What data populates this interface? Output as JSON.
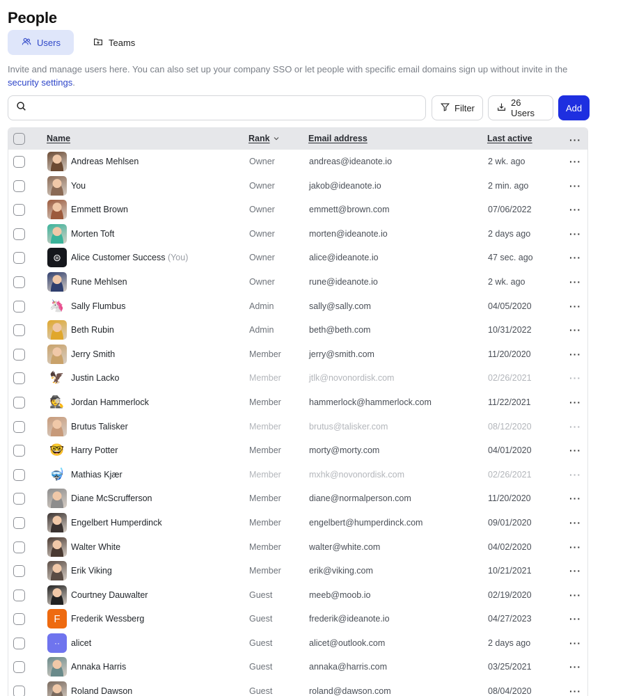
{
  "page": {
    "title": "People"
  },
  "tabs": [
    {
      "label": "Users",
      "icon": "users-icon",
      "active": true
    },
    {
      "label": "Teams",
      "icon": "folder-plus-icon",
      "active": false
    }
  ],
  "intro": {
    "text": "Invite and manage users here. You can also set up your company SSO or let people with specific email domains sign up without invite in the ",
    "link": "security settings",
    "suffix": "."
  },
  "toolbar": {
    "search_placeholder": "",
    "filter_label": "Filter",
    "users_label": "26 Users",
    "add_label": "Add"
  },
  "table": {
    "headers": {
      "name": "Name",
      "rank": "Rank",
      "email": "Email address",
      "last_active": "Last active"
    },
    "rows": [
      {
        "name": "Andreas Mehlsen",
        "suffix": "",
        "rank": "Owner",
        "email": "andreas@ideanote.io",
        "last_active": "2 wk. ago",
        "dim": false,
        "avatar": {
          "kind": "photo",
          "bg": "#6b4a33",
          "glyph": ""
        }
      },
      {
        "name": "You",
        "suffix": "",
        "rank": "Owner",
        "email": "jakob@ideanote.io",
        "last_active": "2 min. ago",
        "dim": false,
        "avatar": {
          "kind": "photo",
          "bg": "#8a6a55",
          "glyph": ""
        }
      },
      {
        "name": "Emmett Brown",
        "suffix": "",
        "rank": "Owner",
        "email": "emmett@brown.com",
        "last_active": "07/06/2022",
        "dim": false,
        "avatar": {
          "kind": "photo",
          "bg": "#9c5a3c",
          "glyph": ""
        }
      },
      {
        "name": "Morten Toft",
        "suffix": "",
        "rank": "Owner",
        "email": "morten@ideanote.io",
        "last_active": "2 days ago",
        "dim": false,
        "avatar": {
          "kind": "photo",
          "bg": "#3ab39a",
          "glyph": ""
        }
      },
      {
        "name": "Alice Customer Success",
        "suffix": "(You)",
        "rank": "Owner",
        "email": "alice@ideanote.io",
        "last_active": "47 sec. ago",
        "dim": false,
        "avatar": {
          "kind": "logo",
          "bg": "#15171c",
          "glyph": "⊜"
        }
      },
      {
        "name": "Rune Mehlsen",
        "suffix": "",
        "rank": "Owner",
        "email": "rune@ideanote.io",
        "last_active": "2 wk. ago",
        "dim": false,
        "avatar": {
          "kind": "photo",
          "bg": "#2f3f6e",
          "glyph": ""
        }
      },
      {
        "name": "Sally Flumbus",
        "suffix": "",
        "rank": "Admin",
        "email": "sally@sally.com",
        "last_active": "04/05/2020",
        "dim": false,
        "avatar": {
          "kind": "emoji",
          "bg": "#ffffff",
          "glyph": "🦄"
        }
      },
      {
        "name": "Beth Rubin",
        "suffix": "",
        "rank": "Admin",
        "email": "beth@beth.com",
        "last_active": "10/31/2022",
        "dim": false,
        "avatar": {
          "kind": "photo",
          "bg": "#e0a72c",
          "glyph": ""
        }
      },
      {
        "name": "Jerry Smith",
        "suffix": "",
        "rank": "Member",
        "email": "jerry@smith.com",
        "last_active": "11/20/2020",
        "dim": false,
        "avatar": {
          "kind": "photo",
          "bg": "#c9a26a",
          "glyph": ""
        }
      },
      {
        "name": "Justin Lacko",
        "suffix": "",
        "rank": "Member",
        "email": "jtlk@novonordisk.com",
        "last_active": "02/26/2021",
        "dim": true,
        "avatar": {
          "kind": "emoji",
          "bg": "#ffffff",
          "glyph": "🦅"
        }
      },
      {
        "name": "Jordan Hammerlock",
        "suffix": "",
        "rank": "Member",
        "email": "hammerlock@hammerlock.com",
        "last_active": "11/22/2021",
        "dim": false,
        "avatar": {
          "kind": "emoji",
          "bg": "#ffffff",
          "glyph": "🕵"
        }
      },
      {
        "name": "Brutus Talisker",
        "suffix": "",
        "rank": "Member",
        "email": "brutus@talisker.com",
        "last_active": "08/12/2020",
        "dim": true,
        "avatar": {
          "kind": "photo",
          "bg": "#c79a7a",
          "glyph": ""
        }
      },
      {
        "name": "Harry Potter",
        "suffix": "",
        "rank": "Member",
        "email": "morty@morty.com",
        "last_active": "04/01/2020",
        "dim": false,
        "avatar": {
          "kind": "emoji",
          "bg": "#ffffff",
          "glyph": "🤓"
        }
      },
      {
        "name": "Mathias Kjær",
        "suffix": "",
        "rank": "Member",
        "email": "mxhk@novonordisk.com",
        "last_active": "02/26/2021",
        "dim": true,
        "avatar": {
          "kind": "emoji",
          "bg": "#ffffff",
          "glyph": "🤿"
        }
      },
      {
        "name": "Diane McScrufferson",
        "suffix": "",
        "rank": "Member",
        "email": "diane@normalperson.com",
        "last_active": "11/20/2020",
        "dim": false,
        "avatar": {
          "kind": "photo",
          "bg": "#8d8d8d",
          "glyph": ""
        }
      },
      {
        "name": "Engelbert Humperdinck",
        "suffix": "",
        "rank": "Member",
        "email": "engelbert@humperdinck.com",
        "last_active": "09/01/2020",
        "dim": false,
        "avatar": {
          "kind": "photo",
          "bg": "#3a3230",
          "glyph": ""
        }
      },
      {
        "name": "Walter White",
        "suffix": "",
        "rank": "Member",
        "email": "walter@white.com",
        "last_active": "04/02/2020",
        "dim": false,
        "avatar": {
          "kind": "photo",
          "bg": "#4a3a32",
          "glyph": ""
        }
      },
      {
        "name": "Erik Viking",
        "suffix": "",
        "rank": "Member",
        "email": "erik@viking.com",
        "last_active": "10/21/2021",
        "dim": false,
        "avatar": {
          "kind": "photo",
          "bg": "#5a4c44",
          "glyph": ""
        }
      },
      {
        "name": "Courtney Dauwalter",
        "suffix": "",
        "rank": "Guest",
        "email": "meeb@moob.io",
        "last_active": "02/19/2020",
        "dim": false,
        "avatar": {
          "kind": "photo",
          "bg": "#222222",
          "glyph": ""
        }
      },
      {
        "name": "Frederik Wessberg",
        "suffix": "",
        "rank": "Guest",
        "email": "frederik@ideanote.io",
        "last_active": "04/27/2023",
        "dim": false,
        "avatar": {
          "kind": "initial",
          "bg": "#ee6a10",
          "glyph": "F"
        }
      },
      {
        "name": "alicet",
        "suffix": "",
        "rank": "Guest",
        "email": "alicet@outlook.com",
        "last_active": "2 days ago",
        "dim": false,
        "avatar": {
          "kind": "bot",
          "bg": "#6f74ee",
          "glyph": "··"
        }
      },
      {
        "name": "Annaka Harris",
        "suffix": "",
        "rank": "Guest",
        "email": "annaka@harris.com",
        "last_active": "03/25/2021",
        "dim": false,
        "avatar": {
          "kind": "photo",
          "bg": "#6a8a8a",
          "glyph": ""
        }
      },
      {
        "name": "Roland Dawson",
        "suffix": "",
        "rank": "Guest",
        "email": "roland@dawson.com",
        "last_active": "08/04/2020",
        "dim": false,
        "avatar": {
          "kind": "photo",
          "bg": "#7a6a5e",
          "glyph": ""
        }
      }
    ]
  }
}
